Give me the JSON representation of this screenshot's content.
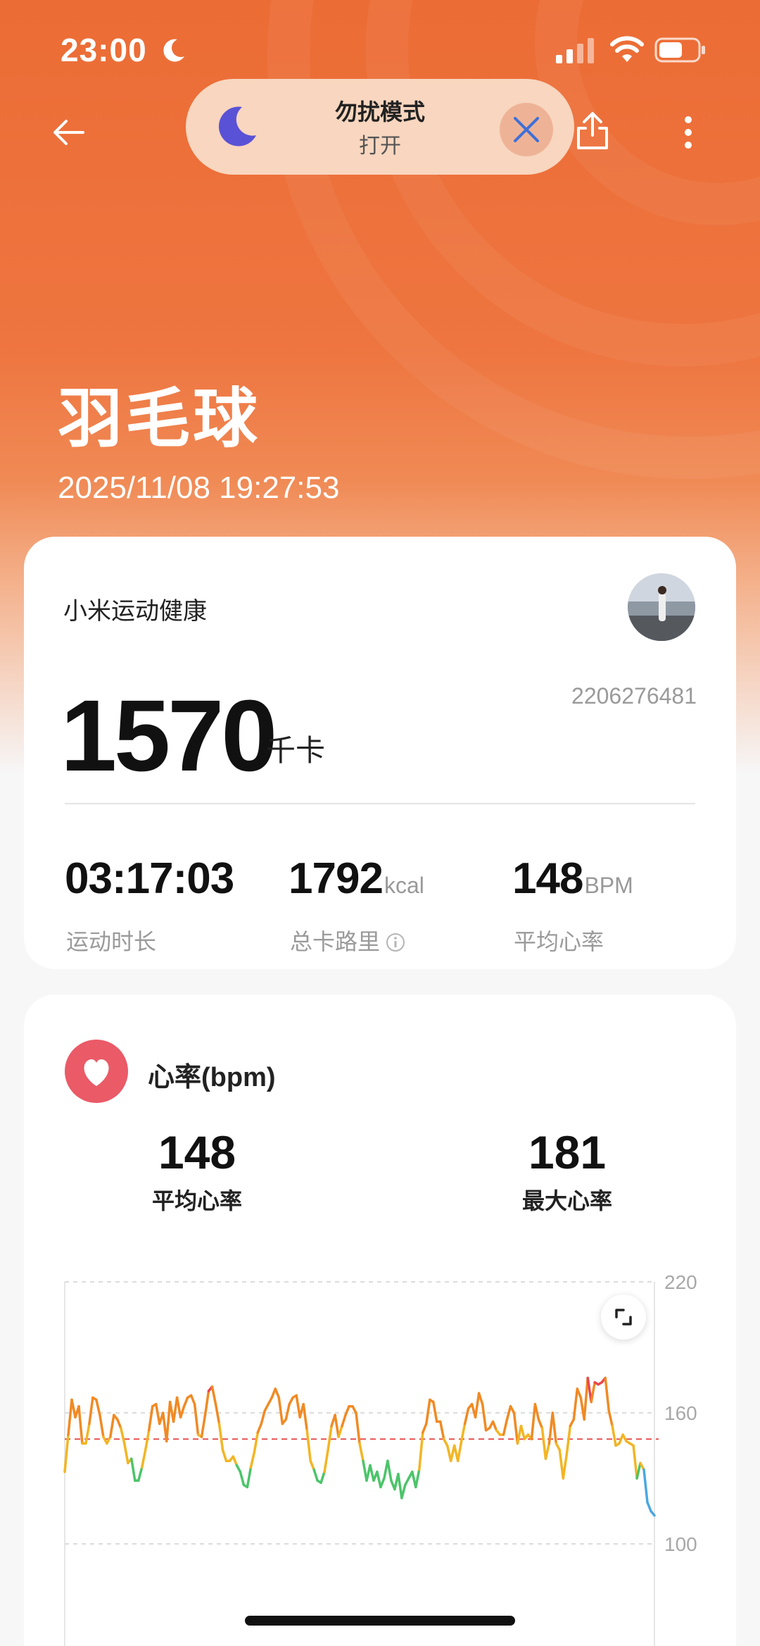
{
  "status_bar": {
    "time": "23:00",
    "icons": [
      "moon-icon",
      "signal-icon",
      "wifi-icon",
      "battery-icon"
    ]
  },
  "dnd_banner": {
    "title": "勿扰模式",
    "subtitle": "打开",
    "icons": [
      "moon-icon",
      "close-icon"
    ]
  },
  "nav": {
    "icons": [
      "back-arrow-icon",
      "share-icon",
      "more-icon"
    ]
  },
  "activity": {
    "title": "羽毛球",
    "datetime": "2025/11/08 19:27:53"
  },
  "summary": {
    "source_app": "小米运动健康",
    "account_id": "2206276481",
    "calories_value": "1570",
    "calories_unit": "千卡",
    "stats": [
      {
        "value": "03:17:03",
        "unit": "",
        "label": "运动时长"
      },
      {
        "value": "1792",
        "unit": "kcal",
        "label": "总卡路里"
      },
      {
        "value": "148",
        "unit": "BPM",
        "label": "平均心率"
      }
    ]
  },
  "heart_rate": {
    "title": "心率(bpm)",
    "avg_value": "148",
    "avg_label": "平均心率",
    "max_value": "181",
    "max_label": "最大心率"
  },
  "chart_data": {
    "type": "line",
    "title": "",
    "xlabel": "",
    "ylabel": "",
    "ylim": [
      100,
      220
    ],
    "y_ticks": [
      "220",
      "160",
      "100"
    ],
    "y_tick_values": [
      220,
      160,
      100
    ],
    "reference_line": 148,
    "colors": {
      "low": "#4cc46a",
      "mid": "#f2b524",
      "high": "#f08a24",
      "peak": "#e8474e",
      "ref": "#e85050",
      "tail": "#4aa8e0"
    },
    "series": [
      {
        "values": [
          133,
          150,
          166,
          158,
          163,
          146,
          146,
          155,
          167,
          166,
          159,
          149,
          146,
          149,
          159,
          157,
          153,
          146,
          137,
          139,
          129,
          129,
          135,
          143,
          152,
          163,
          164,
          155,
          160,
          147,
          165,
          156,
          167,
          158,
          163,
          167,
          168,
          164,
          150,
          149,
          159,
          170,
          172,
          164,
          155,
          143,
          138,
          138,
          140,
          136,
          133,
          127,
          126,
          135,
          142,
          151,
          155,
          161,
          164,
          167,
          171,
          167,
          155,
          157,
          164,
          167,
          168,
          158,
          164,
          152,
          138,
          134,
          129,
          128,
          133,
          143,
          154,
          159,
          149,
          154,
          159,
          163,
          163,
          160,
          146,
          138,
          129,
          136,
          129,
          133,
          126,
          130,
          138,
          129,
          125,
          132,
          121,
          127,
          130,
          133,
          126,
          134,
          151,
          155,
          166,
          165,
          156,
          156,
          148,
          145,
          138,
          145,
          138,
          147,
          155,
          162,
          164,
          158,
          169,
          164,
          152,
          153,
          156,
          152,
          150,
          150,
          157,
          163,
          160,
          146,
          154,
          148,
          150,
          148,
          164,
          157,
          153,
          139,
          146,
          160,
          146,
          143,
          130,
          141,
          154,
          157,
          171,
          167,
          157,
          176,
          165,
          174,
          173,
          174,
          176,
          161,
          154,
          145,
          146,
          150,
          147,
          146,
          145,
          130,
          137,
          134,
          119,
          115,
          113
        ]
      }
    ]
  }
}
